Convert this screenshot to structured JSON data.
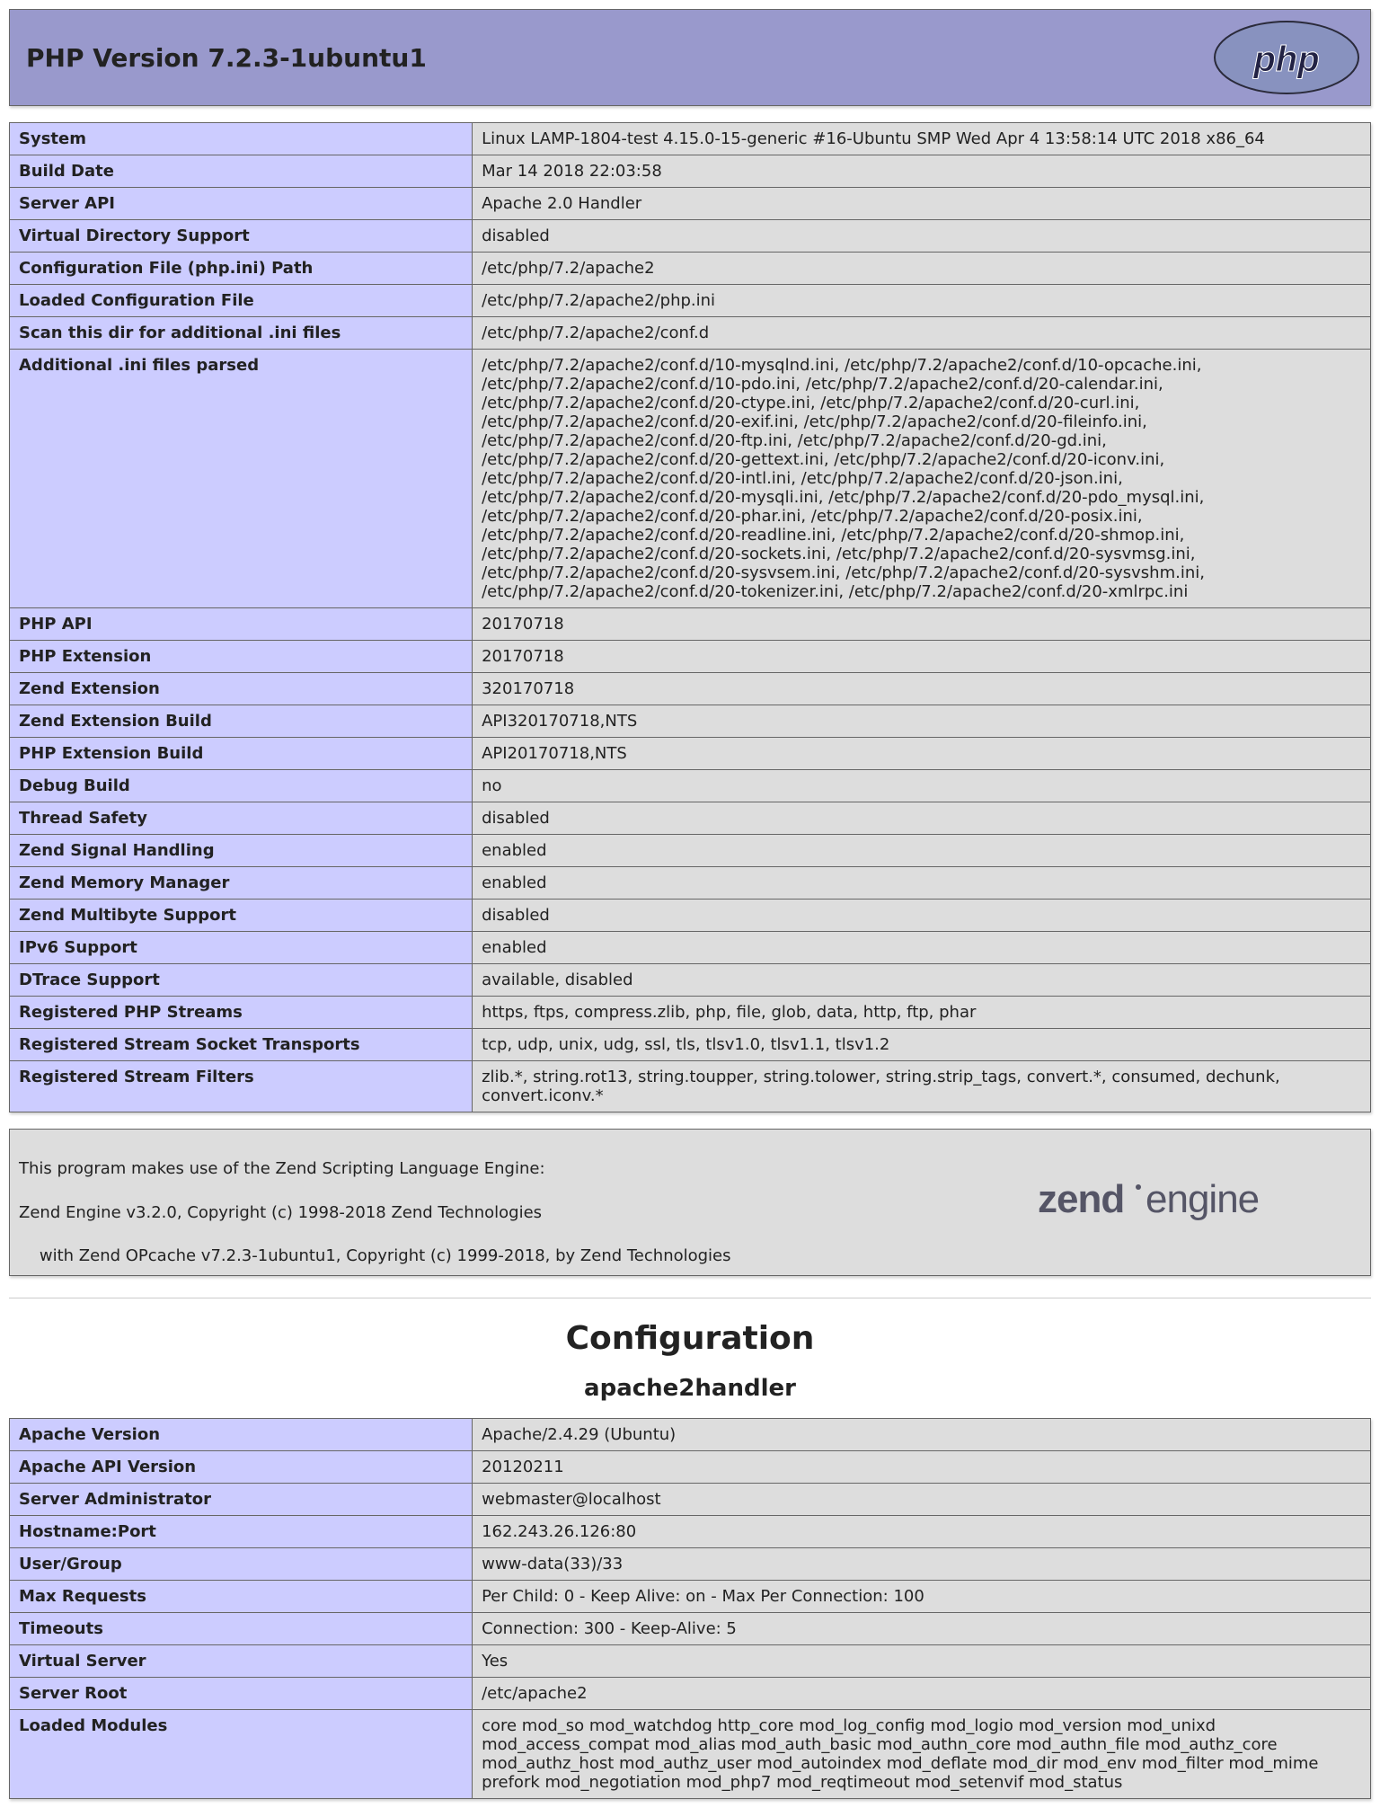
{
  "header": {
    "title": "PHP Version 7.2.3-1ubuntu1"
  },
  "main_table": [
    {
      "label": "System",
      "value": "Linux LAMP-1804-test 4.15.0-15-generic #16-Ubuntu SMP Wed Apr 4 13:58:14 UTC 2018 x86_64"
    },
    {
      "label": "Build Date",
      "value": "Mar 14 2018 22:03:58"
    },
    {
      "label": "Server API",
      "value": "Apache 2.0 Handler"
    },
    {
      "label": "Virtual Directory Support",
      "value": "disabled"
    },
    {
      "label": "Configuration File (php.ini) Path",
      "value": "/etc/php/7.2/apache2"
    },
    {
      "label": "Loaded Configuration File",
      "value": "/etc/php/7.2/apache2/php.ini"
    },
    {
      "label": "Scan this dir for additional .ini files",
      "value": "/etc/php/7.2/apache2/conf.d"
    },
    {
      "label": "Additional .ini files parsed",
      "value": "/etc/php/7.2/apache2/conf.d/10-mysqlnd.ini, /etc/php/7.2/apache2/conf.d/10-opcache.ini, /etc/php/7.2/apache2/conf.d/10-pdo.ini, /etc/php/7.2/apache2/conf.d/20-calendar.ini, /etc/php/7.2/apache2/conf.d/20-ctype.ini, /etc/php/7.2/apache2/conf.d/20-curl.ini, /etc/php/7.2/apache2/conf.d/20-exif.ini, /etc/php/7.2/apache2/conf.d/20-fileinfo.ini, /etc/php/7.2/apache2/conf.d/20-ftp.ini, /etc/php/7.2/apache2/conf.d/20-gd.ini, /etc/php/7.2/apache2/conf.d/20-gettext.ini, /etc/php/7.2/apache2/conf.d/20-iconv.ini, /etc/php/7.2/apache2/conf.d/20-intl.ini, /etc/php/7.2/apache2/conf.d/20-json.ini, /etc/php/7.2/apache2/conf.d/20-mysqli.ini, /etc/php/7.2/apache2/conf.d/20-pdo_mysql.ini, /etc/php/7.2/apache2/conf.d/20-phar.ini, /etc/php/7.2/apache2/conf.d/20-posix.ini, /etc/php/7.2/apache2/conf.d/20-readline.ini, /etc/php/7.2/apache2/conf.d/20-shmop.ini, /etc/php/7.2/apache2/conf.d/20-sockets.ini, /etc/php/7.2/apache2/conf.d/20-sysvmsg.ini, /etc/php/7.2/apache2/conf.d/20-sysvsem.ini, /etc/php/7.2/apache2/conf.d/20-sysvshm.ini, /etc/php/7.2/apache2/conf.d/20-tokenizer.ini, /etc/php/7.2/apache2/conf.d/20-xmlrpc.ini"
    },
    {
      "label": "PHP API",
      "value": "20170718"
    },
    {
      "label": "PHP Extension",
      "value": "20170718"
    },
    {
      "label": "Zend Extension",
      "value": "320170718"
    },
    {
      "label": "Zend Extension Build",
      "value": "API320170718,NTS"
    },
    {
      "label": "PHP Extension Build",
      "value": "API20170718,NTS"
    },
    {
      "label": "Debug Build",
      "value": "no"
    },
    {
      "label": "Thread Safety",
      "value": "disabled"
    },
    {
      "label": "Zend Signal Handling",
      "value": "enabled"
    },
    {
      "label": "Zend Memory Manager",
      "value": "enabled"
    },
    {
      "label": "Zend Multibyte Support",
      "value": "disabled"
    },
    {
      "label": "IPv6 Support",
      "value": "enabled"
    },
    {
      "label": "DTrace Support",
      "value": "available, disabled"
    },
    {
      "label": "Registered PHP Streams",
      "value": "https, ftps, compress.zlib, php, file, glob, data, http, ftp, phar"
    },
    {
      "label": "Registered Stream Socket Transports",
      "value": "tcp, udp, unix, udg, ssl, tls, tlsv1.0, tlsv1.1, tlsv1.2"
    },
    {
      "label": "Registered Stream Filters",
      "value": "zlib.*, string.rot13, string.toupper, string.tolower, string.strip_tags, convert.*, consumed, dechunk, convert.iconv.*"
    }
  ],
  "zend": {
    "line1": "This program makes use of the Zend Scripting Language Engine:",
    "line2": "Zend Engine v3.2.0, Copyright (c) 1998-2018 Zend Technologies",
    "line3": "    with Zend OPcache v7.2.3-1ubuntu1, Copyright (c) 1999-2018, by Zend Technologies"
  },
  "config_heading": "Configuration",
  "apache_heading": "apache2handler",
  "apache_table": [
    {
      "label": "Apache Version",
      "value": "Apache/2.4.29 (Ubuntu)"
    },
    {
      "label": "Apache API Version",
      "value": "20120211"
    },
    {
      "label": "Server Administrator",
      "value": "webmaster@localhost"
    },
    {
      "label": "Hostname:Port",
      "value": "162.243.26.126:80"
    },
    {
      "label": "User/Group",
      "value": "www-data(33)/33"
    },
    {
      "label": "Max Requests",
      "value": "Per Child: 0 - Keep Alive: on - Max Per Connection: 100"
    },
    {
      "label": "Timeouts",
      "value": "Connection: 300 - Keep-Alive: 5"
    },
    {
      "label": "Virtual Server",
      "value": "Yes"
    },
    {
      "label": "Server Root",
      "value": "/etc/apache2"
    },
    {
      "label": "Loaded Modules",
      "value": "core mod_so mod_watchdog http_core mod_log_config mod_logio mod_version mod_unixd mod_access_compat mod_alias mod_auth_basic mod_authn_core mod_authn_file mod_authz_core mod_authz_host mod_authz_user mod_autoindex mod_deflate mod_dir mod_env mod_filter mod_mime prefork mod_negotiation mod_php7 mod_reqtimeout mod_setenvif mod_status"
    }
  ]
}
